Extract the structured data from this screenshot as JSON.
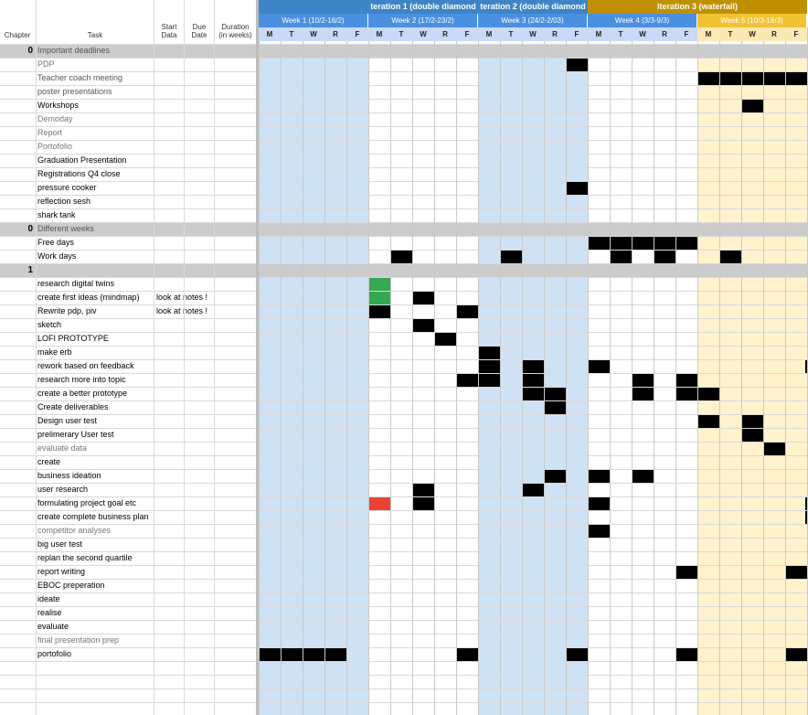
{
  "headers": {
    "chapter": "Chapter",
    "task": "Task",
    "start_date": [
      "Start",
      "Data"
    ],
    "due_date": [
      "Due",
      "Date"
    ],
    "duration": [
      "Duration",
      "(in weeks)"
    ]
  },
  "iterations": [
    {
      "label": "teration 1 (double diamond",
      "color": "#3d85c6"
    },
    {
      "label": "teration 2 (double diamond",
      "color": "#3d85c6"
    },
    {
      "label": "Iteration 3 (waterfall)",
      "color": "#bf9000"
    }
  ],
  "weeks": [
    {
      "label": "Week 1 (10/2-16/2)",
      "color": "#4a90e2"
    },
    {
      "label": "Week 2 (17/2-23/2)",
      "color": "#4a90e2"
    },
    {
      "label": "Week 3 (24/2-2/03)",
      "color": "#4a90e2"
    },
    {
      "label": "Week 4 (3/3-9/3)",
      "color": "#4a90e2"
    },
    {
      "label": "Week 5 (10/3-16/3)",
      "color": "#f1c232"
    }
  ],
  "days": [
    "M",
    "T",
    "W",
    "R",
    "F",
    "M",
    "T",
    "W",
    "R",
    "F",
    "M",
    "T",
    "W",
    "R",
    "F",
    "M",
    "T",
    "W",
    "R",
    "F",
    "M",
    "T",
    "W",
    "R",
    "F"
  ],
  "week_shading": [
    "#cfe2f3",
    "#ffffff",
    "#cfe2f3",
    "#ffffff",
    "#fff2cc"
  ],
  "rows": [
    {
      "chapter": "0",
      "task": "Important deadlines",
      "type": "section",
      "marks": []
    },
    {
      "task": "PDP",
      "color": "#777",
      "marks": [
        14
      ]
    },
    {
      "task": "Teacher coach meeting",
      "color": "#555",
      "marks": [
        20,
        21,
        22,
        23,
        24
      ]
    },
    {
      "task": "poster presentations",
      "color": "#555",
      "marks": []
    },
    {
      "task": "Workshops",
      "color": "#000",
      "marks": [
        22
      ]
    },
    {
      "task": "Demoday",
      "color": "#777",
      "marks": []
    },
    {
      "task": "Report",
      "color": "#777",
      "marks": []
    },
    {
      "task": "Portofolio",
      "color": "#777",
      "marks": []
    },
    {
      "task": "Graduation Presentation",
      "color": "#000",
      "marks": []
    },
    {
      "task": "Registrations Q4 close",
      "color": "#000",
      "marks": []
    },
    {
      "task": "pressure cooker",
      "color": "#000",
      "marks": [
        14
      ]
    },
    {
      "task": "reflection sesh",
      "color": "#000",
      "marks": []
    },
    {
      "task": "shark tank",
      "color": "#000",
      "marks": []
    },
    {
      "chapter": "0",
      "task": "Different weeks",
      "type": "section",
      "marks": []
    },
    {
      "task": "Free days",
      "color": "#000",
      "marks": [
        15,
        16,
        17,
        18,
        19
      ]
    },
    {
      "task": "Work days",
      "color": "#000",
      "marks": [
        6,
        11,
        16,
        18,
        21
      ]
    },
    {
      "chapter": "1",
      "task": "",
      "type": "section",
      "marks": []
    },
    {
      "task": "research digital twins",
      "color": "#000",
      "marks": [],
      "green": [
        5
      ]
    },
    {
      "task": "create first ideas (mindmap)",
      "color": "#000",
      "note": "look at notes !",
      "marks": [
        7
      ],
      "green": [
        5
      ]
    },
    {
      "task": "Rewrite pdp, piv",
      "color": "#000",
      "note": "look at notes !",
      "marks": [
        5,
        9
      ]
    },
    {
      "task": "sketch",
      "color": "#000",
      "marks": [
        7
      ]
    },
    {
      "task": "LOFI PROTOTYPE",
      "color": "#000",
      "marks": [
        8
      ]
    },
    {
      "task": "make erb",
      "color": "#000",
      "marks": [
        10
      ]
    },
    {
      "task": "rework based on feedback",
      "color": "#000",
      "marks": [
        10,
        12,
        15,
        25
      ]
    },
    {
      "task": "research more into topic",
      "color": "#000",
      "marks": [
        9,
        10,
        12,
        17,
        19
      ]
    },
    {
      "task": "create a better prototype",
      "color": "#000",
      "marks": [
        12,
        13,
        17,
        19,
        20
      ]
    },
    {
      "task": "Create deliverables",
      "color": "#000",
      "marks": [
        13
      ]
    },
    {
      "task": "Design user test",
      "color": "#000",
      "marks": [
        20,
        22
      ]
    },
    {
      "task": "prelimerary User test",
      "color": "#000",
      "marks": [
        22
      ]
    },
    {
      "task": "evaluate data",
      "color": "#777",
      "marks": [
        23
      ]
    },
    {
      "task": "create",
      "color": "#000",
      "marks": []
    },
    {
      "task": "business ideation",
      "color": "#000",
      "marks": [
        13,
        15,
        17
      ]
    },
    {
      "task": "user research",
      "color": "#000",
      "marks": [
        7,
        12
      ]
    },
    {
      "task": "formulating project goal etc",
      "color": "#000",
      "marks": [
        7,
        15,
        25
      ],
      "red": [
        5
      ]
    },
    {
      "task": "create complete business plan",
      "color": "#000",
      "marks": [
        25
      ]
    },
    {
      "task": "competitor analyses",
      "color": "#777",
      "marks": [
        15
      ]
    },
    {
      "task": "big user test",
      "color": "#000",
      "marks": []
    },
    {
      "task": "replan the second quartile",
      "color": "#000",
      "marks": []
    },
    {
      "task": "report writing",
      "color": "#000",
      "marks": [
        19,
        24
      ]
    },
    {
      "task": "EBOC preperation",
      "color": "#000",
      "marks": []
    },
    {
      "task": "ideate",
      "color": "#000",
      "marks": []
    },
    {
      "task": "realise",
      "color": "#000",
      "marks": []
    },
    {
      "task": "evaluate",
      "color": "#000",
      "marks": []
    },
    {
      "task": "final presentation prep",
      "color": "#777",
      "marks": []
    },
    {
      "task": "portofolio",
      "color": "#000",
      "marks": [
        0,
        1,
        2,
        3,
        9,
        14,
        19,
        24
      ]
    },
    {
      "task": "",
      "color": "#000",
      "marks": []
    },
    {
      "task": "",
      "color": "#000",
      "marks": []
    }
  ],
  "colors": {
    "section_bg": "#cccccc",
    "mark": "#000000",
    "green": "#34a853",
    "red": "#ea4335"
  }
}
